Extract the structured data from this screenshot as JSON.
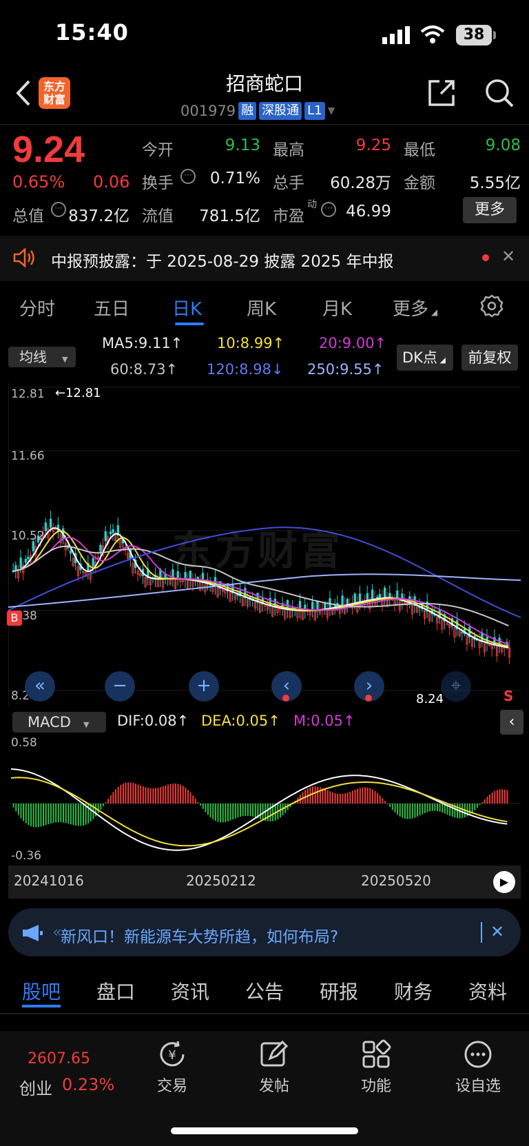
{
  "status": {
    "time": "15:40",
    "battery": "38"
  },
  "header": {
    "logo": "东方财富",
    "name": "招商蛇口",
    "code": "001979",
    "tags": [
      "融",
      "深股通",
      "L1"
    ]
  },
  "quote": {
    "price": "9.24",
    "pct": "0.65%",
    "change": "0.06",
    "fields": [
      {
        "label": "今开",
        "value": "9.13",
        "color": "green"
      },
      {
        "label": "最高",
        "value": "9.25",
        "color": "red"
      },
      {
        "label": "最低",
        "value": "9.08",
        "color": "green"
      },
      {
        "label": "换手",
        "value": "0.71%",
        "color": "white"
      },
      {
        "label": "总手",
        "value": "60.28万",
        "color": "white"
      },
      {
        "label": "金额",
        "value": "5.55亿",
        "color": "white"
      },
      {
        "label": "总值",
        "value": "837.2亿",
        "color": "white"
      },
      {
        "label": "流值",
        "value": "781.5亿",
        "color": "white"
      },
      {
        "label": "市盈",
        "value": "46.99",
        "color": "white"
      }
    ],
    "more": "更多",
    "pe_sup": "动"
  },
  "notice": {
    "text": "中报预披露：于 2025-08-29 披露 2025 年中报"
  },
  "tabs": [
    "分时",
    "五日",
    "日K",
    "周K",
    "月K",
    "更多"
  ],
  "ma": {
    "select": "均线",
    "items": [
      {
        "text": "MA5:9.11↑",
        "color": "#e8e8e8"
      },
      {
        "text": "10:8.99↑",
        "color": "#f3e03a"
      },
      {
        "text": "20:9.00↑",
        "color": "#d23ad6"
      },
      {
        "text": "60:8.73↑",
        "color": "#c8c8c8"
      },
      {
        "text": "120:8.98↓",
        "color": "#5b7cf0"
      },
      {
        "text": "250:9.55↑",
        "color": "#9fb4ff"
      }
    ],
    "dk": "DK点",
    "fq": "前复权"
  },
  "chart_data": {
    "type": "candlestick",
    "y_ticks": [
      "12.81",
      "11.66",
      "10.52",
      "9.38",
      "8.24"
    ],
    "ylim": [
      8.24,
      12.81
    ],
    "max_label": "12.81",
    "min_label": "8.24",
    "markers": [
      "B",
      "S"
    ],
    "watermark": "东方财富",
    "x_labels": [
      "20241016",
      "20250212",
      "20250520"
    ],
    "macd": {
      "select": "MACD",
      "dif": "DIF:0.08↑",
      "dea": "DEA:0.05↑",
      "m": "M:0.05↑",
      "y_ticks": [
        "0.58",
        "-0.36"
      ]
    }
  },
  "ad": {
    "text": "新风口！新能源车大势所趋，如何布局?"
  },
  "bottom_tabs": [
    "股吧",
    "盘口",
    "资讯",
    "公告",
    "研报",
    "财务",
    "资料"
  ],
  "nav": {
    "index_value": "2607.65",
    "index_label": "创业",
    "index_pct": "0.23%",
    "items": [
      "交易",
      "发帖",
      "功能",
      "设自选"
    ]
  }
}
